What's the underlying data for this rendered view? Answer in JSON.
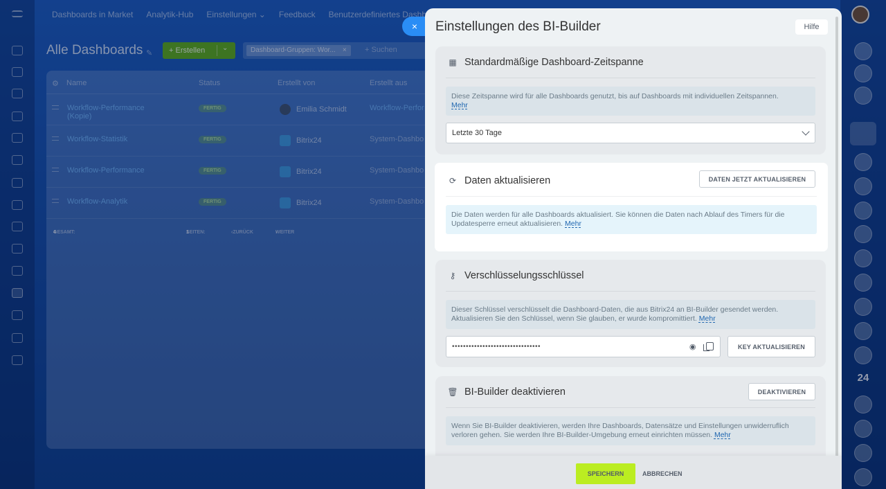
{
  "app": {
    "top_nav": [
      "Dashboards in Market",
      "Analytik-Hub",
      "Einstellungen ⌄",
      "Feedback",
      "Benutzerdefiniertes Dashboa"
    ],
    "page_title": "Alle Dashboards",
    "create_label": "+ Erstellen",
    "filter_tag": "Dashboard-Gruppen: Wor...",
    "search_placeholder": "+ Suchen",
    "table": {
      "headers": [
        "Name",
        "Status",
        "Erstellt von",
        "Erstellt aus"
      ],
      "rows": [
        {
          "name": "Workflow-Performance (Kopie)",
          "status": "FERTIG",
          "author": "Emilia Schmidt",
          "source": "Workflow-Perfor"
        },
        {
          "name": "Workflow-Statistik",
          "status": "FERTIG",
          "author": "Bitrix24",
          "source": "System-Dashbo"
        },
        {
          "name": "Workflow-Performance",
          "status": "FERTIG",
          "author": "Bitrix24",
          "source": "System-Dashbo"
        },
        {
          "name": "Workflow-Analytik",
          "status": "FERTIG",
          "author": "Bitrix24",
          "source": "System-Dashbo"
        }
      ],
      "footer": {
        "total_label": "GESAMT:",
        "total_value": "4",
        "pages_label": "SEITEN:",
        "pages_value": "1",
        "prev": "ZURÜCK",
        "next": "WEITER"
      }
    },
    "right_rail_badge": "24"
  },
  "panel": {
    "title": "Einstellungen des BI-Builder",
    "help_label": "Hilfe",
    "close_icon": "×",
    "sections": {
      "timespan": {
        "title": "Standardmäßige Dashboard-Zeitspanne",
        "info": "Diese Zeitspanne wird für alle Dashboards genutzt, bis auf Dashboards mit individuellen Zeitspannen.",
        "more": "Mehr",
        "select_value": "Letzte 30 Tage"
      },
      "refresh": {
        "title": "Daten aktualisieren",
        "button": "DATEN JETZT AKTUALISIEREN",
        "info": "Die Daten werden für alle Dashboards aktualisiert. Sie können die Daten nach Ablauf des Timers für die Updatesperre erneut aktualisieren.",
        "more": "Mehr"
      },
      "key": {
        "title": "Verschlüsselungsschlüssel",
        "info": "Dieser Schlüssel verschlüsselt die Dashboard-Daten, die aus Bitrix24 an BI-Builder gesendet werden. Aktualisieren Sie den Schlüssel, wenn Sie glauben, er wurde kompromittiert.",
        "more": "Mehr",
        "key_value": "••••••••••••••••••••••••••••••••",
        "button": "KEY AKTUALISIEREN"
      },
      "deactivate": {
        "title": "BI-Builder deaktivieren",
        "button": "DEAKTIVIEREN",
        "info": "Wenn Sie BI-Builder deaktivieren, werden Ihre Dashboards, Datensätze und Einstellungen unwiderruflich verloren gehen. Sie werden Ihre BI-Builder-Umgebung erneut einrichten müssen.",
        "more": "Mehr"
      }
    },
    "footer": {
      "save": "SPEICHERN",
      "cancel": "ABBRECHEN"
    }
  },
  "colors": {
    "accent": "#2a8df5",
    "save": "#bbed21",
    "highlight_info": "#e5f4fb"
  }
}
